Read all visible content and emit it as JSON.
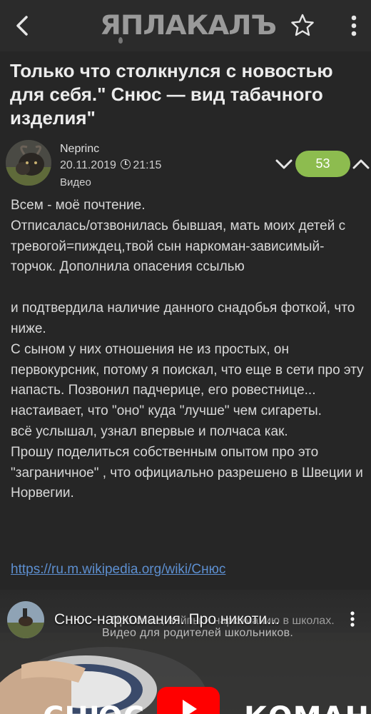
{
  "app": {
    "logo_text": "ЯПЛАКАЛЪ",
    "back_icon": "chevron-left-icon",
    "favorite_icon": "star-outline-icon",
    "menu_icon": "kebab-vertical-icon"
  },
  "post": {
    "title": "Только что столкнулся с новостью для себя.\" Снюс — вид табачного изделия\"",
    "author": "Neprinc",
    "date": "20.11.2019",
    "time": "21:15",
    "category": "Видео",
    "rating": "53",
    "body_paragraphs": [
      "Всем - моё почтение.",
      "Отписалась/отзвонилась бывшая, мать моих детей с тревогой=пиждец,твой сын наркоман-зависимый-торчок. Дополнила опасения ссылью",
      " ",
      "и подтвердила наличие данного снадобья фоткой, что ниже.",
      "С сыном у них отношения не из простых, он первокурсник, потому я поискал, что еще в сети про эту напасть. Позвонил падчерице, его ровестнице... настаивает, что \"оно\" куда \"лучше\" чем сигареты.",
      "всё услышал, узнал впервые и полчаса как.",
      "Прошу поделиться собственным опытом про это \"заграничное\" , что официально разрешено в Швеции и Норвегии."
    ],
    "link_text": "https://ru.m.wikipedia.org/wiki/Снюс"
  },
  "video": {
    "title": "Снюс-наркомания. Про никоти...",
    "overlay_line1": "Про снюс, вейпы и наркоманию в школах.",
    "overlay_line2": "Видео для родителей школьников.",
    "big_text_left": "СНЮС",
    "big_text_right": "КОМАНИЯ"
  },
  "colors": {
    "background": "#262626",
    "rating_badge": "#8dbc4f",
    "link": "#5d8fd0",
    "play_button": "#ff0000"
  }
}
